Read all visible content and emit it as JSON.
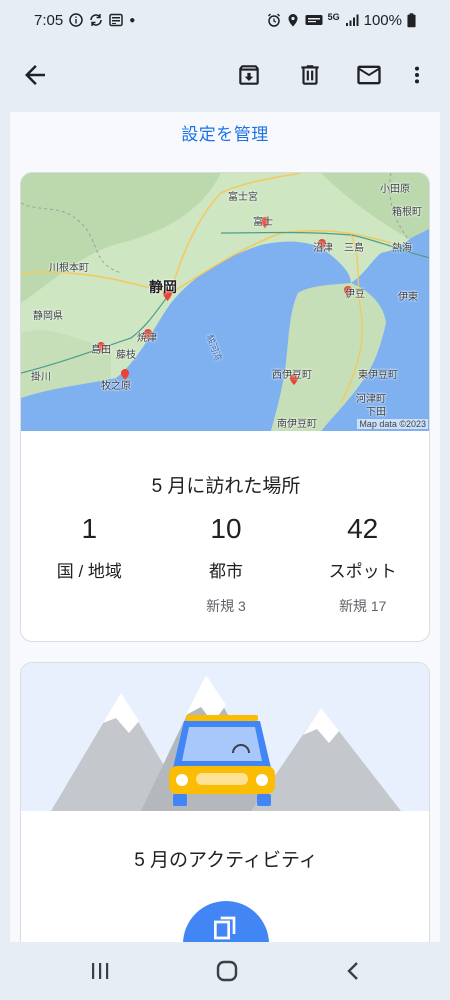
{
  "status_bar": {
    "time": "7:05",
    "battery": "100%",
    "network": "5G"
  },
  "app_bar": {
    "back_icon": "arrow-back-icon",
    "archive_icon": "archive-icon",
    "delete_icon": "delete-icon",
    "mail_icon": "mail-icon",
    "more_icon": "more-vert-icon"
  },
  "manage_link": "設定を管理",
  "map": {
    "credit": "Map data ©2023",
    "places": [
      {
        "name": "富士宮",
        "size": "small"
      },
      {
        "name": "富士",
        "size": "small"
      },
      {
        "name": "小田原",
        "size": "small"
      },
      {
        "name": "箱根町",
        "size": "small"
      },
      {
        "name": "沼津",
        "size": "small"
      },
      {
        "name": "三島",
        "size": "small"
      },
      {
        "name": "熱海",
        "size": "small"
      },
      {
        "name": "川根本町",
        "size": "small"
      },
      {
        "name": "静岡",
        "size": "big"
      },
      {
        "name": "静岡県",
        "size": "small"
      },
      {
        "name": "伊豆",
        "size": "small"
      },
      {
        "name": "伊東",
        "size": "small"
      },
      {
        "name": "島田",
        "size": "small"
      },
      {
        "name": "焼津",
        "size": "small"
      },
      {
        "name": "藤枝",
        "size": "small"
      },
      {
        "name": "駿河湾",
        "size": "small"
      },
      {
        "name": "掛川",
        "size": "small"
      },
      {
        "name": "牧之原",
        "size": "small"
      },
      {
        "name": "西伊豆町",
        "size": "small"
      },
      {
        "name": "東伊豆町",
        "size": "small"
      },
      {
        "name": "河津町",
        "size": "small"
      },
      {
        "name": "下田",
        "size": "small"
      },
      {
        "name": "南伊豆町",
        "size": "small"
      }
    ]
  },
  "visits": {
    "title": "5 月に訪れた場所",
    "stats": [
      {
        "value": "1",
        "label": "国 / 地域",
        "new": ""
      },
      {
        "value": "10",
        "label": "都市",
        "new": "新規 3"
      },
      {
        "value": "42",
        "label": "スポット",
        "new": "新規 17"
      }
    ]
  },
  "activity": {
    "title": "5 月のアクティビティ"
  },
  "nav_bar": {
    "recents_icon": "recents-icon",
    "home_icon": "home-icon",
    "back_icon": "nav-back-icon"
  },
  "colors": {
    "accent": "#1a73e8",
    "pin": "#ea4335",
    "water": "#7fb1f1",
    "land": "#cfe6c2",
    "activity_button": "#4285f4",
    "car": "#4285f4"
  }
}
